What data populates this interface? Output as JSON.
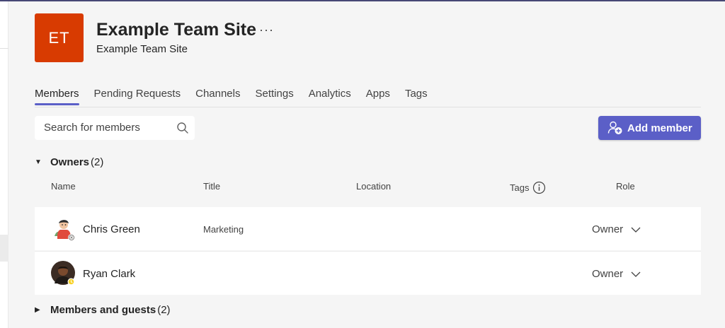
{
  "team": {
    "initials": "ET",
    "tile_color": "#d83b01",
    "title": "Example Team Site",
    "more_label": "···",
    "subtitle": "Example Team Site"
  },
  "tabs": [
    {
      "label": "Members",
      "active": true
    },
    {
      "label": "Pending Requests",
      "active": false
    },
    {
      "label": "Channels",
      "active": false
    },
    {
      "label": "Settings",
      "active": false
    },
    {
      "label": "Analytics",
      "active": false
    },
    {
      "label": "Apps",
      "active": false
    },
    {
      "label": "Tags",
      "active": false
    }
  ],
  "search": {
    "placeholder": "Search for members",
    "icon": "search-icon"
  },
  "add_member": {
    "label": "Add member",
    "icon": "add-person-icon",
    "color": "#5b5fc7"
  },
  "owners": {
    "caret": "▼",
    "title": "Owners",
    "count": "(2)"
  },
  "columns": {
    "name": "Name",
    "title": "Title",
    "location": "Location",
    "tags": "Tags",
    "role": "Role"
  },
  "members_rows": [
    {
      "name": "Chris Green",
      "title": "Marketing",
      "location": "",
      "role": "Owner",
      "presence": "offline"
    },
    {
      "name": "Ryan Clark",
      "title": "",
      "location": "",
      "role": "Owner",
      "presence": "away"
    }
  ],
  "guests": {
    "caret": "▶",
    "title": "Members and guests",
    "count": "(2)"
  }
}
